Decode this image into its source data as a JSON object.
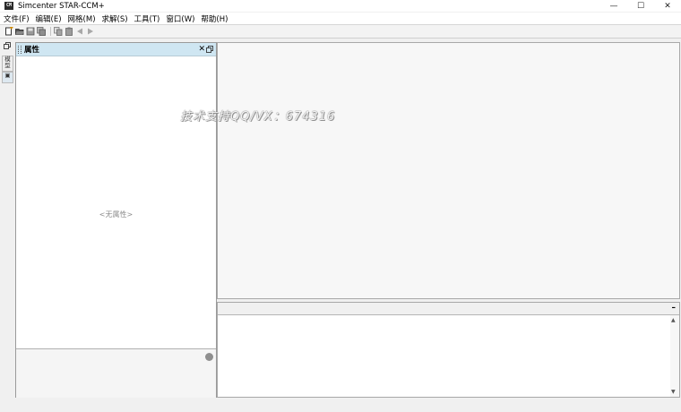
{
  "window": {
    "title": "Simcenter STAR-CCM+",
    "logo": "CM",
    "controls": {
      "minimize": "—",
      "maximize": "☐",
      "close": "✕"
    }
  },
  "menu": [
    {
      "label": "文件(F)"
    },
    {
      "label": "编辑(E)"
    },
    {
      "label": "网格(M)"
    },
    {
      "label": "求解(S)"
    },
    {
      "label": "工具(T)"
    },
    {
      "label": "窗口(W)"
    },
    {
      "label": "帮助(H)"
    }
  ],
  "toolbar": {
    "icons": [
      "new-simulation-icon",
      "open-folder-icon",
      "save-icon",
      "save-all-icon",
      "copy-icon",
      "clipboard-icon",
      "back-arrow-icon",
      "forward-arrow-icon"
    ]
  },
  "sidebar": {
    "tabs": [
      {
        "label": "模型"
      },
      {
        "label": "▣"
      }
    ]
  },
  "properties": {
    "title": "属性",
    "close": "✕",
    "empty_text": "<无属性>"
  },
  "graphics": {
    "watermark": "技术支持QQ/VX：674316"
  },
  "output": {
    "minimize": "–",
    "scroll_up": "▲",
    "scroll_down": "▼"
  },
  "colors": {
    "panel_header": "#cfe6f2",
    "background": "#f0f0f0"
  }
}
